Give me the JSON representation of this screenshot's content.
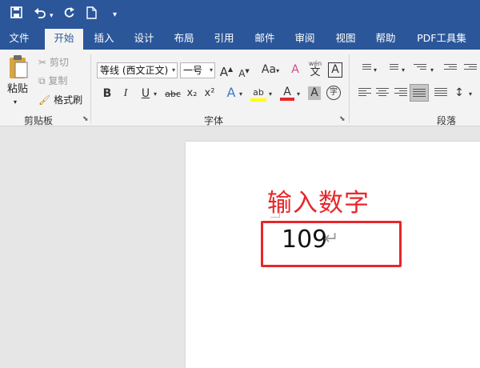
{
  "quick_access": {
    "save_icon": "save-icon",
    "undo_icon": "undo-icon",
    "redo_icon": "redo-icon",
    "new_icon": "new-document-icon",
    "customize_icon": "customize-toolbar-icon"
  },
  "tabs": [
    "文件",
    "开始",
    "插入",
    "设计",
    "布局",
    "引用",
    "邮件",
    "审阅",
    "视图",
    "帮助",
    "PDF工具集"
  ],
  "active_tab": "开始",
  "clipboard": {
    "paste": "粘贴",
    "cut": "剪切",
    "copy": "复制",
    "format_painter": "格式刷",
    "group_label": "剪贴板"
  },
  "font": {
    "font_name": "等线 (西文正文)",
    "font_size": "一号",
    "grow": "A",
    "shrink": "A",
    "change_case": "Aa",
    "clear_format": "A",
    "phonetic_top": "wén",
    "phonetic_bottom": "文",
    "char_border": "A",
    "bold": "B",
    "italic": "I",
    "underline": "U",
    "strikethrough": "abc",
    "subscript": "x₂",
    "superscript": "x²",
    "text_effects": "A",
    "highlight": "ab",
    "font_color": "A",
    "char_shading": "A",
    "enclose": "字",
    "group_label": "字体"
  },
  "paragraph": {
    "group_label": "段落"
  },
  "document": {
    "annotation": "输入数字",
    "text": "109",
    "paragraph_mark": "↵"
  },
  "colors": {
    "accent": "#2b579a",
    "annotation_red": "#e8262b"
  }
}
